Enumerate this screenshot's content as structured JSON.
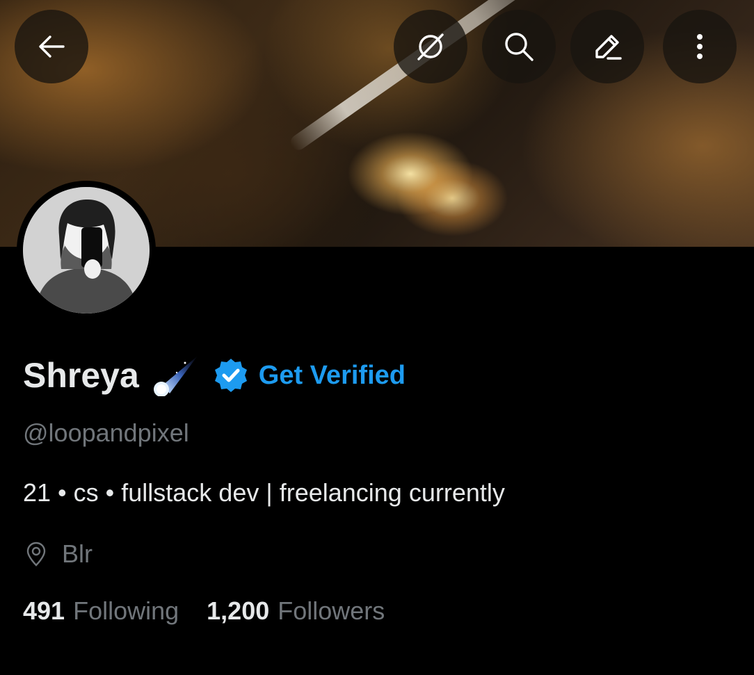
{
  "header": {
    "back_icon": "arrow-left-icon",
    "grok_icon": "grok-icon",
    "search_icon": "search-icon",
    "edit_icon": "edit-icon",
    "more_icon": "more-vertical-icon"
  },
  "profile": {
    "display_name": "Shreya",
    "name_emoji": "comet",
    "verified_badge": "verified-badge-icon",
    "get_verified_label": "Get Verified",
    "handle": "@loopandpixel",
    "bio": "21 • cs • fullstack dev | freelancing currently",
    "location_icon": "location-pin-icon",
    "location": "Blr"
  },
  "stats": {
    "following_count": "491",
    "following_label": "Following",
    "followers_count": "1,200",
    "followers_label": "Followers"
  },
  "colors": {
    "background": "#000000",
    "primary_text": "#e7e9ea",
    "secondary_text": "#71767b",
    "accent": "#1d9bf0"
  }
}
